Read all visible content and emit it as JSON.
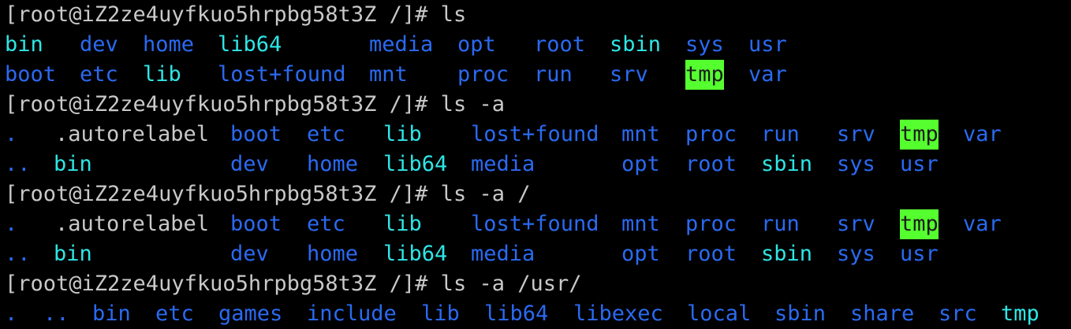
{
  "theme": {
    "background": "#000000",
    "prompt": "#c9c9c9",
    "file": "#c9c9c9",
    "dir": "#2a6af2",
    "link": "#2fe6e6",
    "tmp_fg": "#1a1a1a",
    "tmp_bg": "#55ff2f"
  },
  "lines": [
    {
      "kind": "prompt",
      "text": "[root@iZ2ze4uyfkuo5hrpbg58t3Z /]# ls"
    },
    {
      "kind": "output",
      "tokens": [
        {
          "text": "bin",
          "type": "link"
        },
        {
          "text": "dev",
          "type": "dir"
        },
        {
          "text": "home",
          "type": "dir"
        },
        {
          "text": "lib64",
          "type": "link"
        },
        {
          "text": "media",
          "type": "dir"
        },
        {
          "text": "opt",
          "type": "dir"
        },
        {
          "text": "root",
          "type": "dir"
        },
        {
          "text": "sbin",
          "type": "link"
        },
        {
          "text": "sys",
          "type": "dir"
        },
        {
          "text": "usr",
          "type": "dir"
        }
      ]
    },
    {
      "kind": "output",
      "tokens": [
        {
          "text": "boot",
          "type": "dir"
        },
        {
          "text": "etc",
          "type": "dir"
        },
        {
          "text": "lib",
          "type": "link"
        },
        {
          "text": "lost+found",
          "type": "dir"
        },
        {
          "text": "mnt",
          "type": "dir"
        },
        {
          "text": "proc",
          "type": "dir"
        },
        {
          "text": "run",
          "type": "dir"
        },
        {
          "text": "srv",
          "type": "dir"
        },
        {
          "text": "tmp",
          "type": "hl"
        },
        {
          "text": "var",
          "type": "dir"
        }
      ]
    },
    {
      "kind": "prompt",
      "text": "[root@iZ2ze4uyfkuo5hrpbg58t3Z /]# ls -a"
    },
    {
      "kind": "output",
      "tokens": [
        {
          "text": ".",
          "type": "dir"
        },
        {
          "text": ".autorelabel",
          "type": "file"
        },
        {
          "text": "boot",
          "type": "dir"
        },
        {
          "text": "etc",
          "type": "dir"
        },
        {
          "text": "lib",
          "type": "link"
        },
        {
          "text": "lost+found",
          "type": "dir"
        },
        {
          "text": "mnt",
          "type": "dir"
        },
        {
          "text": "proc",
          "type": "dir"
        },
        {
          "text": "run",
          "type": "dir"
        },
        {
          "text": "srv",
          "type": "dir"
        },
        {
          "text": "tmp",
          "type": "hl"
        },
        {
          "text": "var",
          "type": "dir"
        }
      ]
    },
    {
      "kind": "output",
      "tokens": [
        {
          "text": "..",
          "type": "dir"
        },
        {
          "text": "bin",
          "type": "link"
        },
        {
          "text": "dev",
          "type": "dir"
        },
        {
          "text": "home",
          "type": "dir"
        },
        {
          "text": "lib64",
          "type": "link"
        },
        {
          "text": "media",
          "type": "dir"
        },
        {
          "text": "opt",
          "type": "dir"
        },
        {
          "text": "root",
          "type": "dir"
        },
        {
          "text": "sbin",
          "type": "link"
        },
        {
          "text": "sys",
          "type": "dir"
        },
        {
          "text": "usr",
          "type": "dir"
        }
      ]
    },
    {
      "kind": "prompt",
      "text": "[root@iZ2ze4uyfkuo5hrpbg58t3Z /]# ls -a /"
    },
    {
      "kind": "output",
      "tokens": [
        {
          "text": ".",
          "type": "dir"
        },
        {
          "text": ".autorelabel",
          "type": "file"
        },
        {
          "text": "boot",
          "type": "dir"
        },
        {
          "text": "etc",
          "type": "dir"
        },
        {
          "text": "lib",
          "type": "link"
        },
        {
          "text": "lost+found",
          "type": "dir"
        },
        {
          "text": "mnt",
          "type": "dir"
        },
        {
          "text": "proc",
          "type": "dir"
        },
        {
          "text": "run",
          "type": "dir"
        },
        {
          "text": "srv",
          "type": "dir"
        },
        {
          "text": "tmp",
          "type": "hl"
        },
        {
          "text": "var",
          "type": "dir"
        }
      ]
    },
    {
      "kind": "output",
      "tokens": [
        {
          "text": "..",
          "type": "dir"
        },
        {
          "text": "bin",
          "type": "link"
        },
        {
          "text": "dev",
          "type": "dir"
        },
        {
          "text": "home",
          "type": "dir"
        },
        {
          "text": "lib64",
          "type": "link"
        },
        {
          "text": "media",
          "type": "dir"
        },
        {
          "text": "opt",
          "type": "dir"
        },
        {
          "text": "root",
          "type": "dir"
        },
        {
          "text": "sbin",
          "type": "link"
        },
        {
          "text": "sys",
          "type": "dir"
        },
        {
          "text": "usr",
          "type": "dir"
        }
      ]
    },
    {
      "kind": "prompt",
      "text": "[root@iZ2ze4uyfkuo5hrpbg58t3Z /]# ls -a /usr/"
    },
    {
      "kind": "output",
      "tokens": [
        {
          "text": ".",
          "type": "dir"
        },
        {
          "text": "..",
          "type": "dir"
        },
        {
          "text": "bin",
          "type": "dir"
        },
        {
          "text": "etc",
          "type": "dir"
        },
        {
          "text": "games",
          "type": "dir"
        },
        {
          "text": "include",
          "type": "dir"
        },
        {
          "text": "lib",
          "type": "dir"
        },
        {
          "text": "lib64",
          "type": "dir"
        },
        {
          "text": "libexec",
          "type": "dir"
        },
        {
          "text": "local",
          "type": "dir"
        },
        {
          "text": "sbin",
          "type": "dir"
        },
        {
          "text": "share",
          "type": "dir"
        },
        {
          "text": "src",
          "type": "dir"
        },
        {
          "text": "tmp",
          "type": "link"
        }
      ]
    }
  ]
}
